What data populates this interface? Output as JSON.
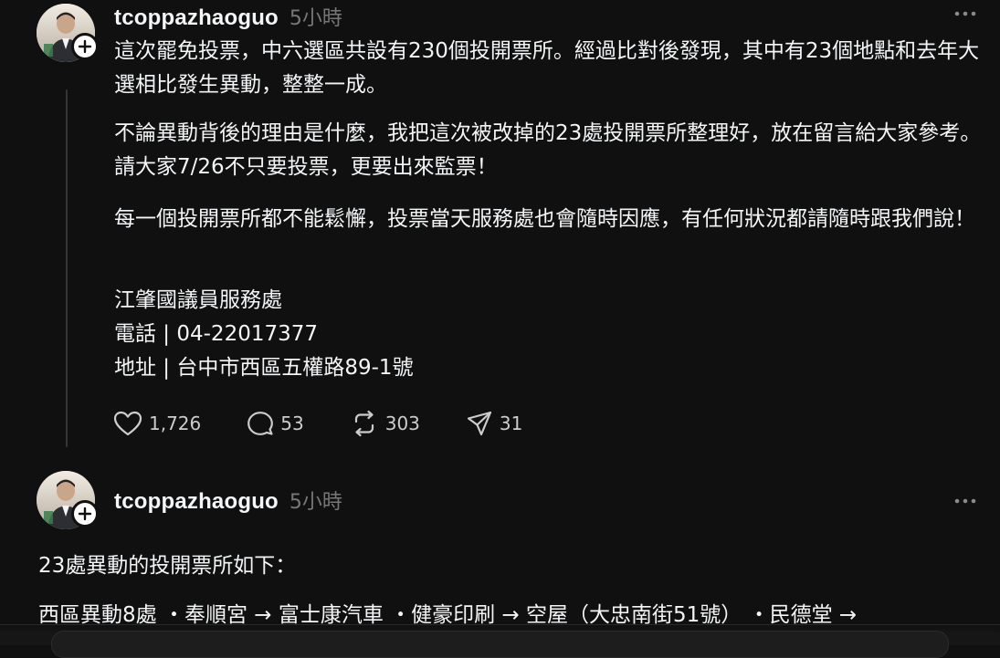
{
  "post1": {
    "username": "tcoppazhaoguo",
    "timestamp": "5小時",
    "paragraphs": [
      "這次罷免投票，中六選區共設有230個投開票所。經過比對後發現，其中有23個地點和去年大選相比發生異動，整整一成。",
      "不論異動背後的理由是什麼，我把這次被改掉的23處投開票所整理好，放在留言給大家參考。請大家7/26不只要投票，更要出來監票！",
      "每一個投開票所都不能鬆懈，投票當天服務處也會隨時因應，有任何狀況都請隨時跟我們說！"
    ],
    "contact": {
      "office": "江肇國議員服務處",
      "phone": "電話 | 04-22017377",
      "address": "地址 | 台中市西區五權路89-1號"
    },
    "actions": {
      "likes": "1,726",
      "comments": "53",
      "reposts": "303",
      "shares": "31"
    }
  },
  "post2": {
    "username": "tcoppazhaoguo",
    "timestamp": "5小時",
    "line1": "23處異動的投開票所如下：",
    "line2": "西區異動8處 ・奉順宮 → 富士康汽車 ・健豪印刷 → 空屋（大忠南街51號） ・民德堂 →"
  },
  "icons": {
    "more": "more-icon",
    "follow": "plus-icon",
    "like": "heart-icon",
    "comment": "comment-icon",
    "repost": "repost-icon",
    "share": "share-icon"
  },
  "colors": {
    "background": "#101010",
    "text": "#f3f5f7",
    "muted": "#777777",
    "thread_line": "#333638"
  }
}
